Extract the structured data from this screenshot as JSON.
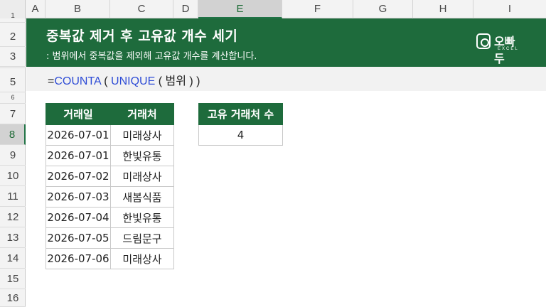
{
  "columns": [
    "A",
    "B",
    "C",
    "D",
    "E",
    "F",
    "G",
    "H",
    "I"
  ],
  "rows": [
    "1",
    "2",
    "3",
    "4",
    "5",
    "6",
    "7",
    "8",
    "9",
    "10",
    "11",
    "12",
    "13",
    "14",
    "15",
    "16"
  ],
  "active_column": "E",
  "active_row": "8",
  "banner": {
    "title": "중복값 제거 후 고유값 개수 세기",
    "subtitle": ": 범위에서 중복값을 제외해 고유값 개수를 계산합니다.",
    "logo_text": "오빠두",
    "logo_sub": "EXCEL",
    "logo_icon": "camera-square-icon"
  },
  "formula": {
    "prefix": "=",
    "fn1": "COUNTA",
    "sep1": " ( ",
    "fn2": "UNIQUE",
    "sep2": " ( ",
    "arg": "범위",
    "suffix": " ) )"
  },
  "table": {
    "headers": [
      "거래일",
      "거래처"
    ],
    "rows": [
      [
        "2026-07-01",
        "미래상사"
      ],
      [
        "2026-07-01",
        "한빛유통"
      ],
      [
        "2026-07-02",
        "미래상사"
      ],
      [
        "2026-07-03",
        "새봄식품"
      ],
      [
        "2026-07-04",
        "한빛유통"
      ],
      [
        "2026-07-05",
        "드림문구"
      ],
      [
        "2026-07-06",
        "미래상사"
      ]
    ]
  },
  "result": {
    "header": "고유 거래처 수",
    "value": "4"
  },
  "colors": {
    "accent": "#1e6b3c",
    "function": "#2f4dd6",
    "selection": "#217346"
  }
}
